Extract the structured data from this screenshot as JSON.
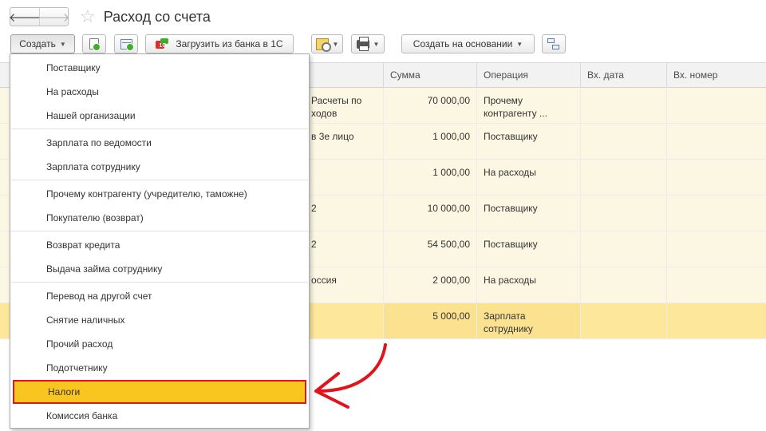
{
  "nav": {
    "back": "🡐",
    "forward": "🡒"
  },
  "title": "Расход со счета",
  "toolbar": {
    "create": "Создать",
    "load_bank": "Загрузить из банка в 1С",
    "create_based": "Создать на основании"
  },
  "table": {
    "headers": {
      "sum": "Сумма",
      "operation": "Операция",
      "in_date": "Вх. дата",
      "in_number": "Вх. номер"
    },
    "rows": [
      {
        "partner": "Расчеты по ходов",
        "sum": "70 000,00",
        "operation": "Прочему контрагенту ..."
      },
      {
        "partner": "в 3е лицо",
        "sum": "1 000,00",
        "operation": "Поставщику"
      },
      {
        "partner": "",
        "sum": "1 000,00",
        "operation": "На расходы"
      },
      {
        "partner": "2",
        "sum": "10 000,00",
        "operation": "Поставщику"
      },
      {
        "partner": "2",
        "sum": "54 500,00",
        "operation": "Поставщику"
      },
      {
        "partner": "оссия",
        "sum": "2 000,00",
        "operation": "На расходы"
      },
      {
        "partner": "",
        "sum": "5 000,00",
        "operation": "Зарплата сотруднику"
      }
    ]
  },
  "menu": {
    "items": [
      "Поставщику",
      "На расходы",
      "Нашей организации",
      "Зарплата по ведомости",
      "Зарплата сотруднику",
      "Прочему контрагенту (учредителю, таможне)",
      "Покупателю (возврат)",
      "Возврат кредита",
      "Выдача займа сотруднику",
      "Перевод на другой счет",
      "Снятие наличных",
      "Прочий расход",
      "Подотчетнику",
      "Налоги",
      "Комиссия банка"
    ],
    "highlighted": "Налоги"
  },
  "colors": {
    "highlight": "#f9c51f",
    "highlight_border": "#e3131b",
    "arrow": "#e3131b",
    "row_bg": "#fbf7e3",
    "selected_row": "#fce79b"
  }
}
